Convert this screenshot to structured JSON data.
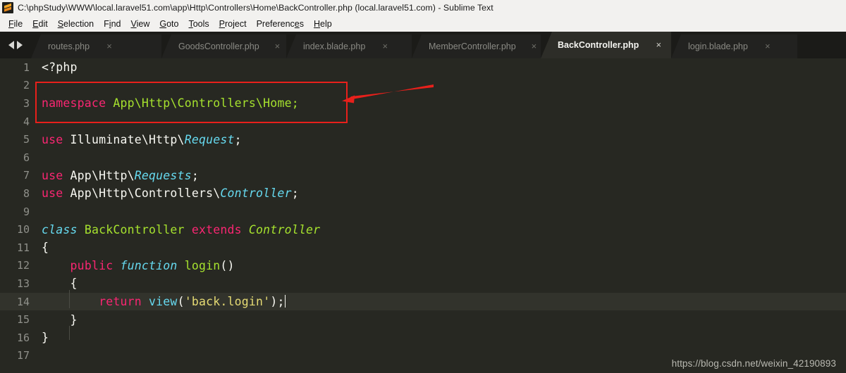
{
  "window": {
    "title": "C:\\phpStudy\\WWW\\local.laravel51.com\\app\\Http\\Controllers\\Home\\BackController.php (local.laravel51.com) - Sublime Text",
    "app_icon": "sublime-text-icon"
  },
  "menubar": {
    "items": [
      {
        "label": "File",
        "mnemonic_index": 0
      },
      {
        "label": "Edit",
        "mnemonic_index": 0
      },
      {
        "label": "Selection",
        "mnemonic_index": 0
      },
      {
        "label": "Find",
        "mnemonic_index": 1
      },
      {
        "label": "View",
        "mnemonic_index": 0
      },
      {
        "label": "Goto",
        "mnemonic_index": 0
      },
      {
        "label": "Tools",
        "mnemonic_index": 0
      },
      {
        "label": "Project",
        "mnemonic_index": 0
      },
      {
        "label": "Preferences",
        "mnemonic_index": 9
      },
      {
        "label": "Help",
        "mnemonic_index": 0
      }
    ]
  },
  "tabbar": {
    "nav_prev": "previous-tab-arrow",
    "nav_next": "next-tab-arrow",
    "close_glyph": "×",
    "tabs": [
      {
        "label": "routes.php",
        "active": false,
        "width": 185
      },
      {
        "label": "GoodsController.php",
        "active": false,
        "width": 177
      },
      {
        "label": "index.blade.php",
        "active": false,
        "width": 178
      },
      {
        "label": "MemberController.php",
        "active": false,
        "width": 183
      },
      {
        "label": "BackController.php",
        "active": true,
        "width": 185
      },
      {
        "label": "login.blade.php",
        "active": false,
        "width": 179
      }
    ]
  },
  "editor": {
    "language": "PHP",
    "theme": "Monokai",
    "cursor_line": 14,
    "lines": [
      {
        "n": "1",
        "tokens": [
          {
            "t": "<?php",
            "c": "k-plain"
          }
        ]
      },
      {
        "n": "2",
        "tokens": []
      },
      {
        "n": "3",
        "tokens": [
          {
            "t": "namespace",
            "c": "k-key"
          },
          {
            "t": " ",
            "c": "k-plain"
          },
          {
            "t": "App\\Http\\Controllers\\Home;",
            "c": "k-ns"
          }
        ]
      },
      {
        "n": "4",
        "tokens": []
      },
      {
        "n": "5",
        "tokens": [
          {
            "t": "use",
            "c": "k-key"
          },
          {
            "t": " Illuminate\\Http\\",
            "c": "k-plain"
          },
          {
            "t": "Request",
            "c": "k-type"
          },
          {
            "t": ";",
            "c": "k-plain"
          }
        ]
      },
      {
        "n": "6",
        "tokens": []
      },
      {
        "n": "7",
        "tokens": [
          {
            "t": "use",
            "c": "k-key"
          },
          {
            "t": " App\\Http\\",
            "c": "k-plain"
          },
          {
            "t": "Requests",
            "c": "k-type"
          },
          {
            "t": ";",
            "c": "k-plain"
          }
        ]
      },
      {
        "n": "8",
        "tokens": [
          {
            "t": "use",
            "c": "k-key"
          },
          {
            "t": " App\\Http\\Controllers\\",
            "c": "k-plain"
          },
          {
            "t": "Controller",
            "c": "k-type"
          },
          {
            "t": ";",
            "c": "k-plain"
          }
        ]
      },
      {
        "n": "9",
        "tokens": []
      },
      {
        "n": "10",
        "tokens": [
          {
            "t": "class",
            "c": "k-cls"
          },
          {
            "t": " ",
            "c": "k-plain"
          },
          {
            "t": "BackController",
            "c": "k-name"
          },
          {
            "t": " ",
            "c": "k-plain"
          },
          {
            "t": "extends",
            "c": "k-key"
          },
          {
            "t": " ",
            "c": "k-plain"
          },
          {
            "t": "Controller",
            "c": "k-name-i"
          }
        ]
      },
      {
        "n": "11",
        "tokens": [
          {
            "t": "{",
            "c": "k-punc"
          }
        ]
      },
      {
        "n": "12",
        "tokens": [
          {
            "t": "    ",
            "c": "k-plain"
          },
          {
            "t": "public",
            "c": "k-key"
          },
          {
            "t": " ",
            "c": "k-plain"
          },
          {
            "t": "function",
            "c": "k-cls"
          },
          {
            "t": " ",
            "c": "k-plain"
          },
          {
            "t": "login",
            "c": "k-name"
          },
          {
            "t": "()",
            "c": "k-punc"
          }
        ]
      },
      {
        "n": "13",
        "tokens": [
          {
            "t": "    {",
            "c": "k-punc"
          }
        ]
      },
      {
        "n": "14",
        "tokens": [
          {
            "t": "        ",
            "c": "k-plain"
          },
          {
            "t": "return",
            "c": "k-key"
          },
          {
            "t": " ",
            "c": "k-plain"
          },
          {
            "t": "view",
            "c": "k-fn"
          },
          {
            "t": "(",
            "c": "k-punc"
          },
          {
            "t": "'back.login'",
            "c": "k-str"
          },
          {
            "t": ");",
            "c": "k-punc"
          }
        ],
        "caret": true,
        "active": true
      },
      {
        "n": "15",
        "tokens": [
          {
            "t": "    }",
            "c": "k-punc"
          }
        ]
      },
      {
        "n": "16",
        "tokens": [
          {
            "t": "}",
            "c": "k-punc"
          }
        ]
      },
      {
        "n": "17",
        "tokens": []
      }
    ]
  },
  "annotations": {
    "highlight_rect": {
      "target_line": 3,
      "color": "#e8201b"
    },
    "arrow": {
      "color": "#e8201b",
      "points_to": "namespace-line"
    }
  },
  "watermark": {
    "text": "https://blog.csdn.net/weixin_42190893"
  },
  "colors": {
    "editor_bg": "#272822",
    "active_line_bg": "#32332c",
    "tabbar_bg": "#1b1b18",
    "tab_inactive_bg": "#222220",
    "tab_active_bg": "#2d2d28",
    "titlebar_bg": "#f2f1ef",
    "keyword": "#f92672",
    "string": "#e6db74",
    "type": "#66d9ef",
    "name": "#a6e22e",
    "text": "#f8f8f2",
    "gutter": "#8f908a",
    "annotation": "#e8201b"
  }
}
